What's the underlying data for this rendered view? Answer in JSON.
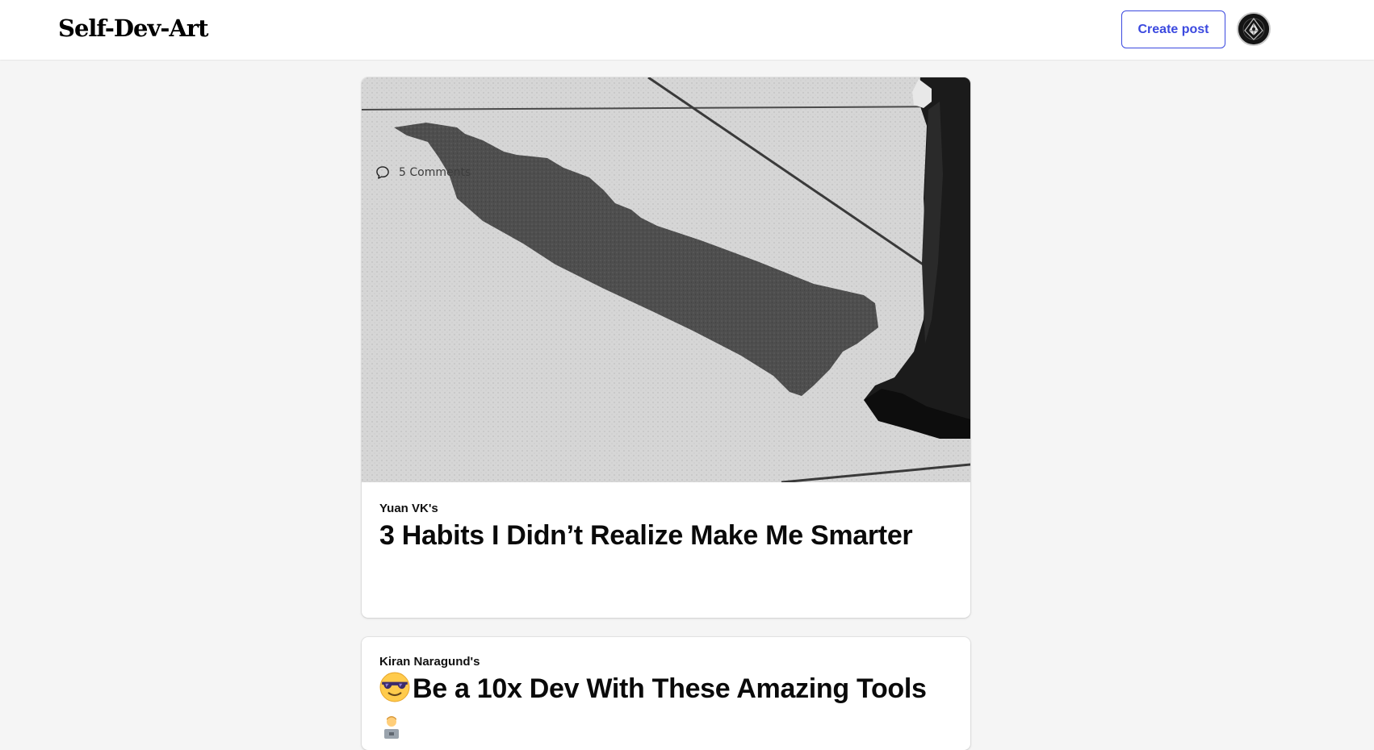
{
  "header": {
    "logo_text": "Self-Dev-Art",
    "create_post_label": "Create post",
    "accent_color": "#3b49df"
  },
  "posts": [
    {
      "author": "Yuan VK's",
      "title": "3 Habits I Didn’t Realize Make Me Smarter",
      "comments_label": "5 Comments",
      "cover_description": "grayscale-photo-graduate-shadow-on-pavement"
    },
    {
      "author": "Kiran Naragund's",
      "title": "Be a 10x Dev With These Amazing Tools",
      "leading_emoji": "smiling-face-with-sunglasses",
      "trailing_emoji": "technologist"
    }
  ]
}
